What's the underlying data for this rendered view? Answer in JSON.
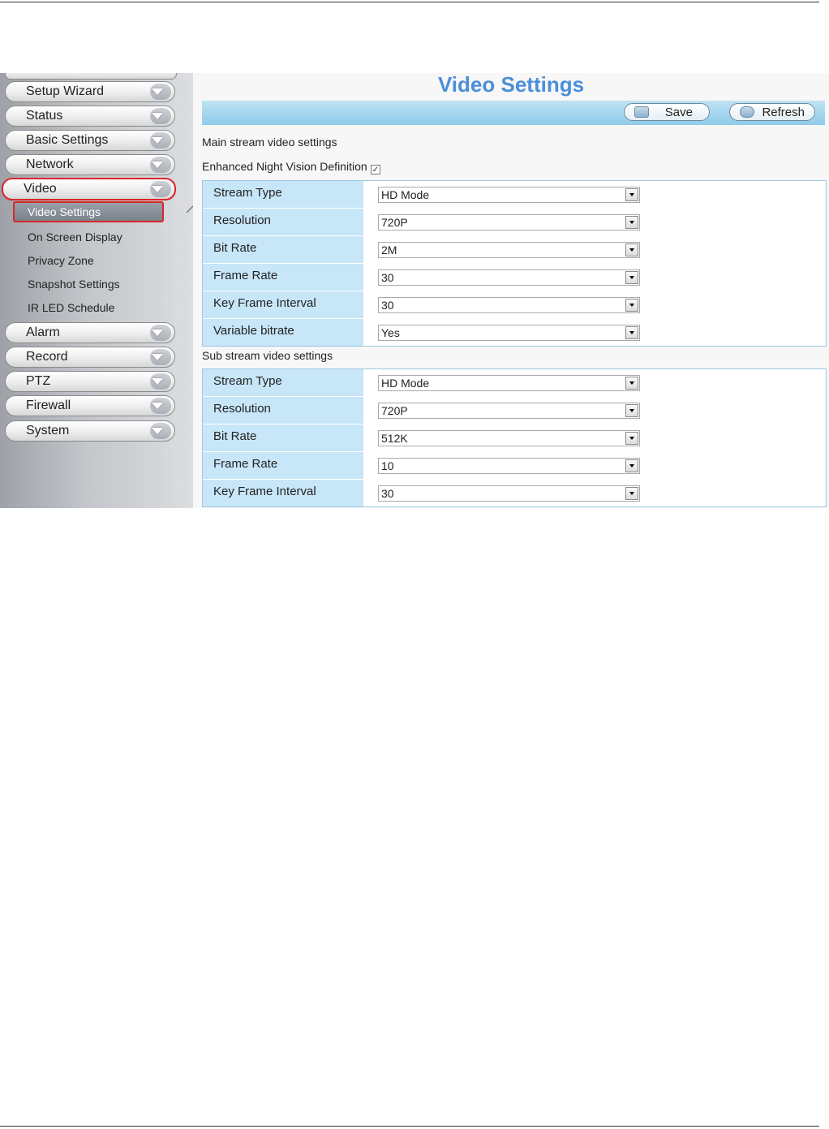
{
  "page": {
    "title": "Video Settings"
  },
  "sidebar": {
    "top_cut_label": "",
    "menu": [
      {
        "label": "Setup Wizard",
        "active": false
      },
      {
        "label": "Status",
        "active": false
      },
      {
        "label": "Basic Settings",
        "active": false
      },
      {
        "label": "Network",
        "active": false
      },
      {
        "label": "Video",
        "active": true
      },
      {
        "label": "Alarm",
        "active": false
      },
      {
        "label": "Record",
        "active": false
      },
      {
        "label": "PTZ",
        "active": false
      },
      {
        "label": "Firewall",
        "active": false
      },
      {
        "label": "System",
        "active": false
      }
    ],
    "video_submenu": [
      {
        "label": "Video Settings",
        "active": true
      },
      {
        "label": "On Screen Display",
        "active": false
      },
      {
        "label": "Privacy Zone",
        "active": false
      },
      {
        "label": "Snapshot Settings",
        "active": false
      },
      {
        "label": "IR LED Schedule",
        "active": false
      }
    ]
  },
  "toolbar": {
    "save_label": "Save",
    "refresh_label": "Refresh"
  },
  "main_stream": {
    "section_label": "Main stream video settings",
    "night_vision_label": "Enhanced Night Vision Definition",
    "night_vision_checked": true,
    "rows": [
      {
        "label": "Stream Type",
        "value": "HD Mode"
      },
      {
        "label": "Resolution",
        "value": "720P"
      },
      {
        "label": "Bit Rate",
        "value": "2M"
      },
      {
        "label": "Frame Rate",
        "value": "30"
      },
      {
        "label": "Key Frame Interval",
        "value": "30"
      },
      {
        "label": "Variable bitrate",
        "value": "Yes"
      }
    ]
  },
  "sub_stream": {
    "section_label": "Sub stream video settings",
    "rows": [
      {
        "label": "Stream Type",
        "value": "HD Mode"
      },
      {
        "label": "Resolution",
        "value": "720P"
      },
      {
        "label": "Bit Rate",
        "value": "512K"
      },
      {
        "label": "Frame Rate",
        "value": "10"
      },
      {
        "label": "Key Frame Interval",
        "value": "30"
      }
    ]
  },
  "colors": {
    "title": "#4a8fd9",
    "highlight_border": "#d9262a",
    "label_cell": "#c7e6f8",
    "toolbar": "#8fcbe9"
  }
}
